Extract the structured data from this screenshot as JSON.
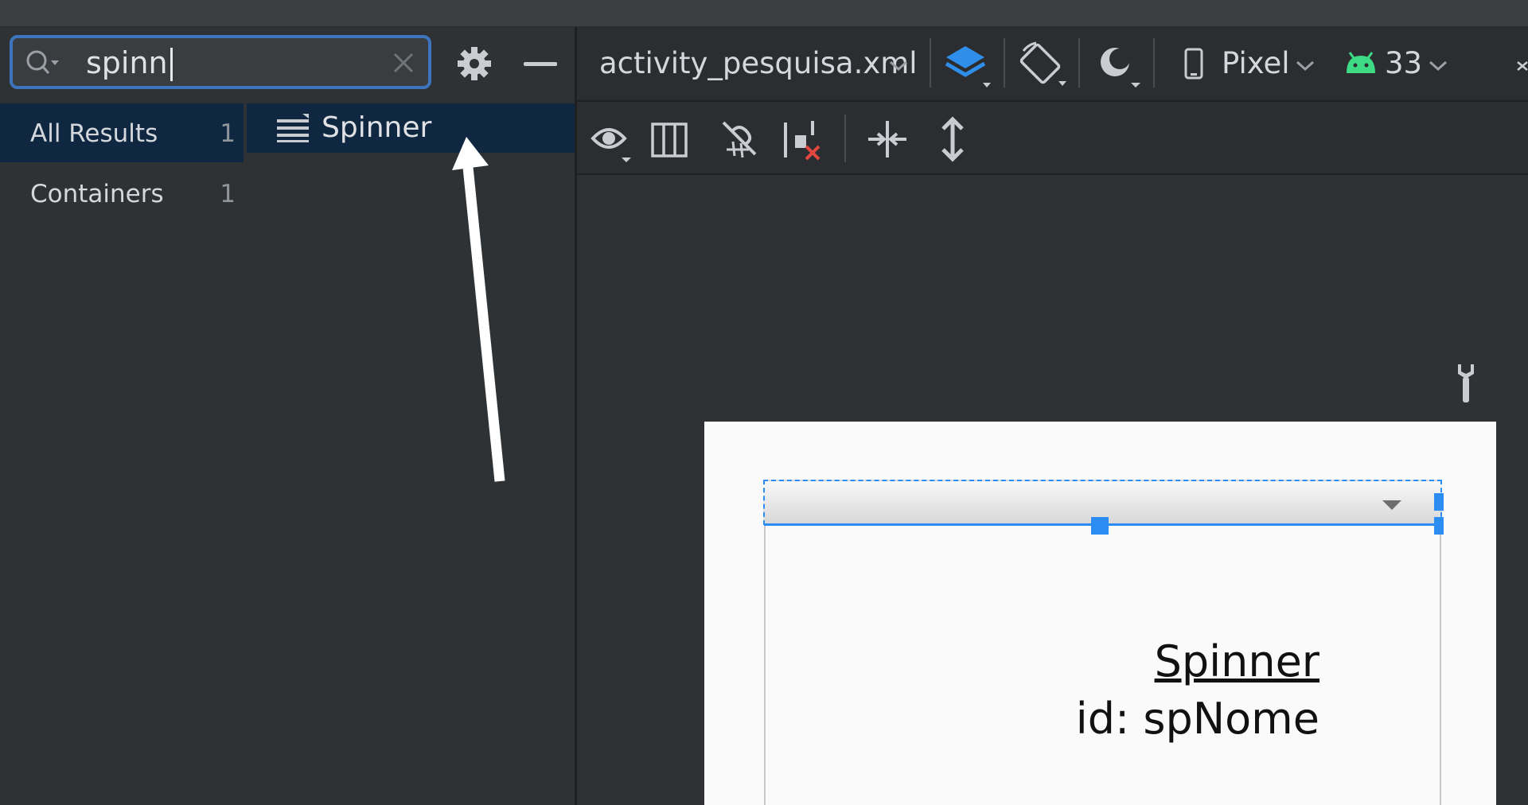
{
  "palette": {
    "search": {
      "value": "spinn",
      "placeholder": ""
    },
    "categories": [
      {
        "label": "All Results",
        "count": "1",
        "selected": true
      },
      {
        "label": "Containers",
        "count": "1",
        "selected": false
      }
    ],
    "results": [
      {
        "label": "Spinner",
        "icon": "spinner-widget-icon"
      }
    ]
  },
  "editor": {
    "file_name": "activity_pesquisa.xml",
    "device": "Pixel",
    "api_level": "33",
    "toolbar_icons": [
      "design-surface-icon",
      "orientation-icon",
      "theme-icon",
      "device-icon",
      "android-icon",
      "view-options-icon",
      "blueprint-icon",
      "autoconnect-icon",
      "clear-constraints-icon",
      "guidelines-icon",
      "pack-icon"
    ]
  },
  "canvas": {
    "selected_view": {
      "name": "Spinner",
      "id_text": "id: spNome"
    }
  },
  "colors": {
    "selection_blue": "#2b8cf3",
    "search_border": "#3d74bd",
    "android_green": "#3ddc84",
    "layer_blue": "#2f8eea"
  }
}
